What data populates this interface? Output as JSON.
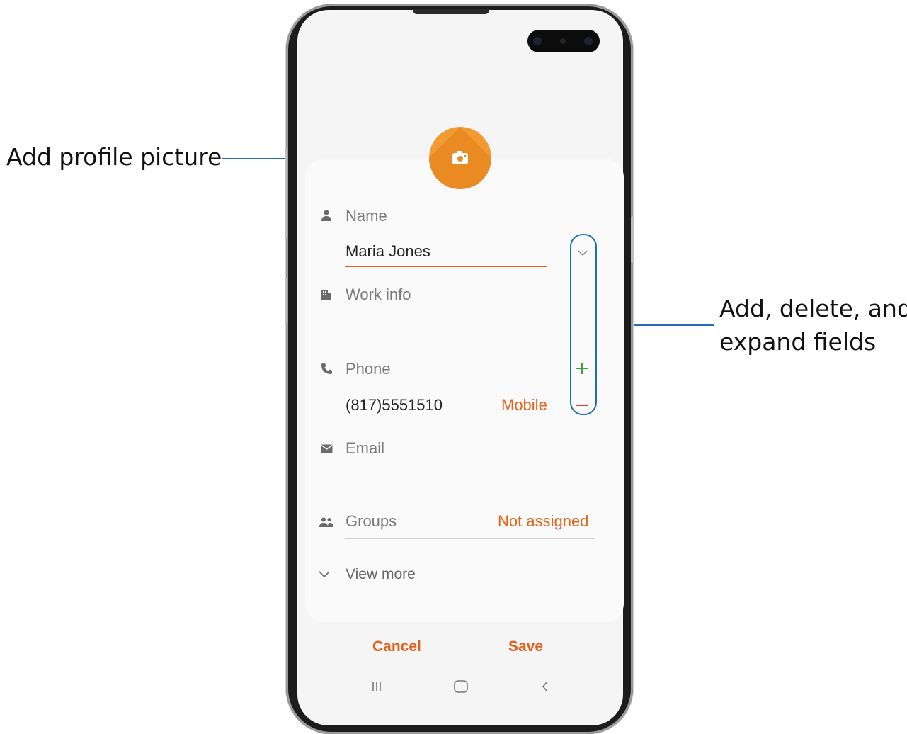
{
  "annotations": {
    "profile_picture": "Add profile picture",
    "fields_line1": "Add, delete, and",
    "fields_line2": "expand fields"
  },
  "form": {
    "name": {
      "label": "Name",
      "value": "Maria Jones",
      "icon": "person-icon"
    },
    "work_info": {
      "label": "Work info",
      "icon": "building-icon"
    },
    "phone": {
      "label": "Phone",
      "value": "(817)5551510",
      "type": "Mobile",
      "icon": "phone-icon"
    },
    "email": {
      "label": "Email",
      "icon": "envelope-icon"
    },
    "groups": {
      "label": "Groups",
      "value": "Not assigned",
      "icon": "groups-icon"
    },
    "view_more": "View more"
  },
  "actions": {
    "cancel": "Cancel",
    "save": "Save"
  },
  "colors": {
    "accent": "#e8621c",
    "avatar": "#f39b33",
    "add": "#3aa53a",
    "annotation": "#1f6fb2"
  }
}
